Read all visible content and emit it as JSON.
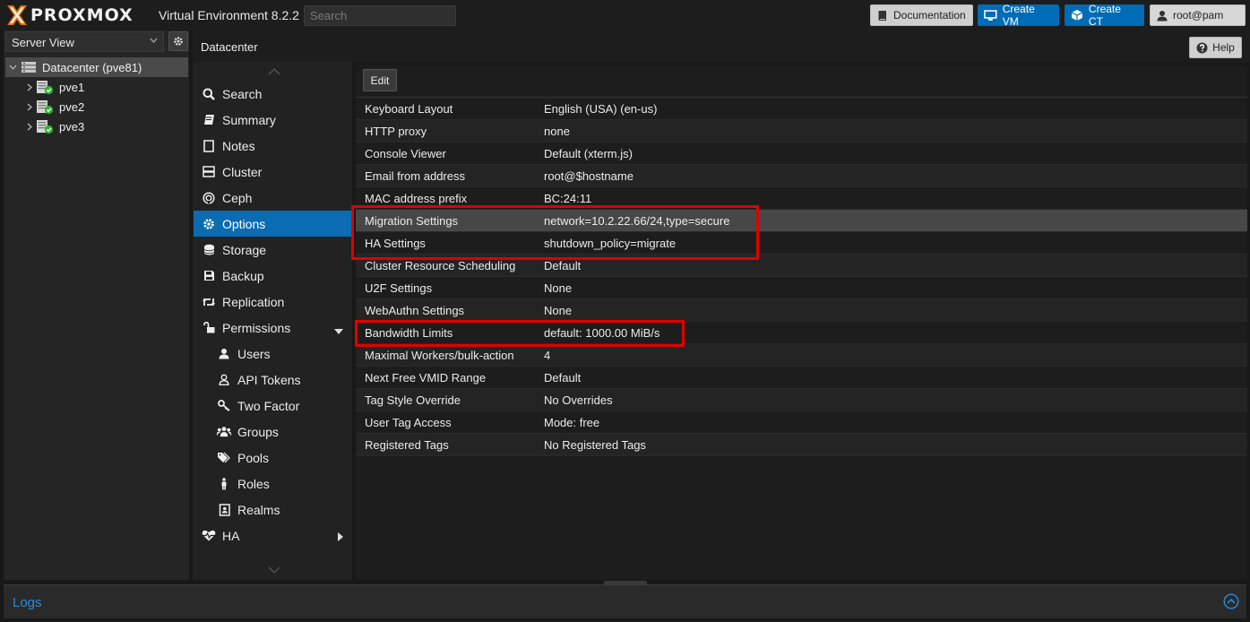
{
  "app": {
    "brand": "PROXMOX",
    "version_label": "Virtual Environment 8.2.2"
  },
  "header": {
    "search_placeholder": "Search",
    "documentation_label": "Documentation",
    "create_vm_label": "Create VM",
    "create_ct_label": "Create CT",
    "user_label": "root@pam"
  },
  "tree": {
    "view_label": "Server View",
    "datacenter_label": "Datacenter (pve81)",
    "nodes": [
      "pve1",
      "pve2",
      "pve3"
    ]
  },
  "main": {
    "title": "Datacenter",
    "help_label": "Help",
    "edit_label": "Edit"
  },
  "nav": [
    {
      "label": "Search",
      "icon": "search-icon"
    },
    {
      "label": "Summary",
      "icon": "book-icon"
    },
    {
      "label": "Notes",
      "icon": "notes-icon"
    },
    {
      "label": "Cluster",
      "icon": "server-icon"
    },
    {
      "label": "Ceph",
      "icon": "ceph-icon"
    },
    {
      "label": "Options",
      "icon": "gear-icon",
      "active": true
    },
    {
      "label": "Storage",
      "icon": "database-icon"
    },
    {
      "label": "Backup",
      "icon": "floppy-icon"
    },
    {
      "label": "Replication",
      "icon": "retweet-icon"
    },
    {
      "label": "Permissions",
      "icon": "unlock-icon",
      "expanded": true
    },
    {
      "label": "Users",
      "icon": "user-icon",
      "sub": true
    },
    {
      "label": "API Tokens",
      "icon": "user-outline-icon",
      "sub": true
    },
    {
      "label": "Two Factor",
      "icon": "key-icon",
      "sub": true
    },
    {
      "label": "Groups",
      "icon": "users-icon",
      "sub": true
    },
    {
      "label": "Pools",
      "icon": "tags-icon",
      "sub": true
    },
    {
      "label": "Roles",
      "icon": "male-icon",
      "sub": true
    },
    {
      "label": "Realms",
      "icon": "address-book-icon",
      "sub": true
    },
    {
      "label": "HA",
      "icon": "heartbeat-icon",
      "collapsed": true
    }
  ],
  "options": [
    {
      "key": "Keyboard Layout",
      "value": "English (USA) (en-us)"
    },
    {
      "key": "HTTP proxy",
      "value": "none"
    },
    {
      "key": "Console Viewer",
      "value": "Default (xterm.js)"
    },
    {
      "key": "Email from address",
      "value": "root@$hostname"
    },
    {
      "key": "MAC address prefix",
      "value": "BC:24:11"
    },
    {
      "key": "Migration Settings",
      "value": "network=10.2.22.66/24,type=secure",
      "selected": true
    },
    {
      "key": "HA Settings",
      "value": "shutdown_policy=migrate"
    },
    {
      "key": "Cluster Resource Scheduling",
      "value": "Default"
    },
    {
      "key": "U2F Settings",
      "value": "None"
    },
    {
      "key": "WebAuthn Settings",
      "value": "None"
    },
    {
      "key": "Bandwidth Limits",
      "value": "default: 1000.00 MiB/s"
    },
    {
      "key": "Maximal Workers/bulk-action",
      "value": "4"
    },
    {
      "key": "Next Free VMID Range",
      "value": "Default"
    },
    {
      "key": "Tag Style Override",
      "value": "No Overrides"
    },
    {
      "key": "User Tag Access",
      "value": "Mode: free"
    },
    {
      "key": "Registered Tags",
      "value": "No Registered Tags"
    }
  ],
  "logs": {
    "title": "Logs"
  },
  "colors": {
    "accent": "#0b6bb3",
    "highlight_box": "#e00000",
    "status_ok": "#2db32d"
  }
}
